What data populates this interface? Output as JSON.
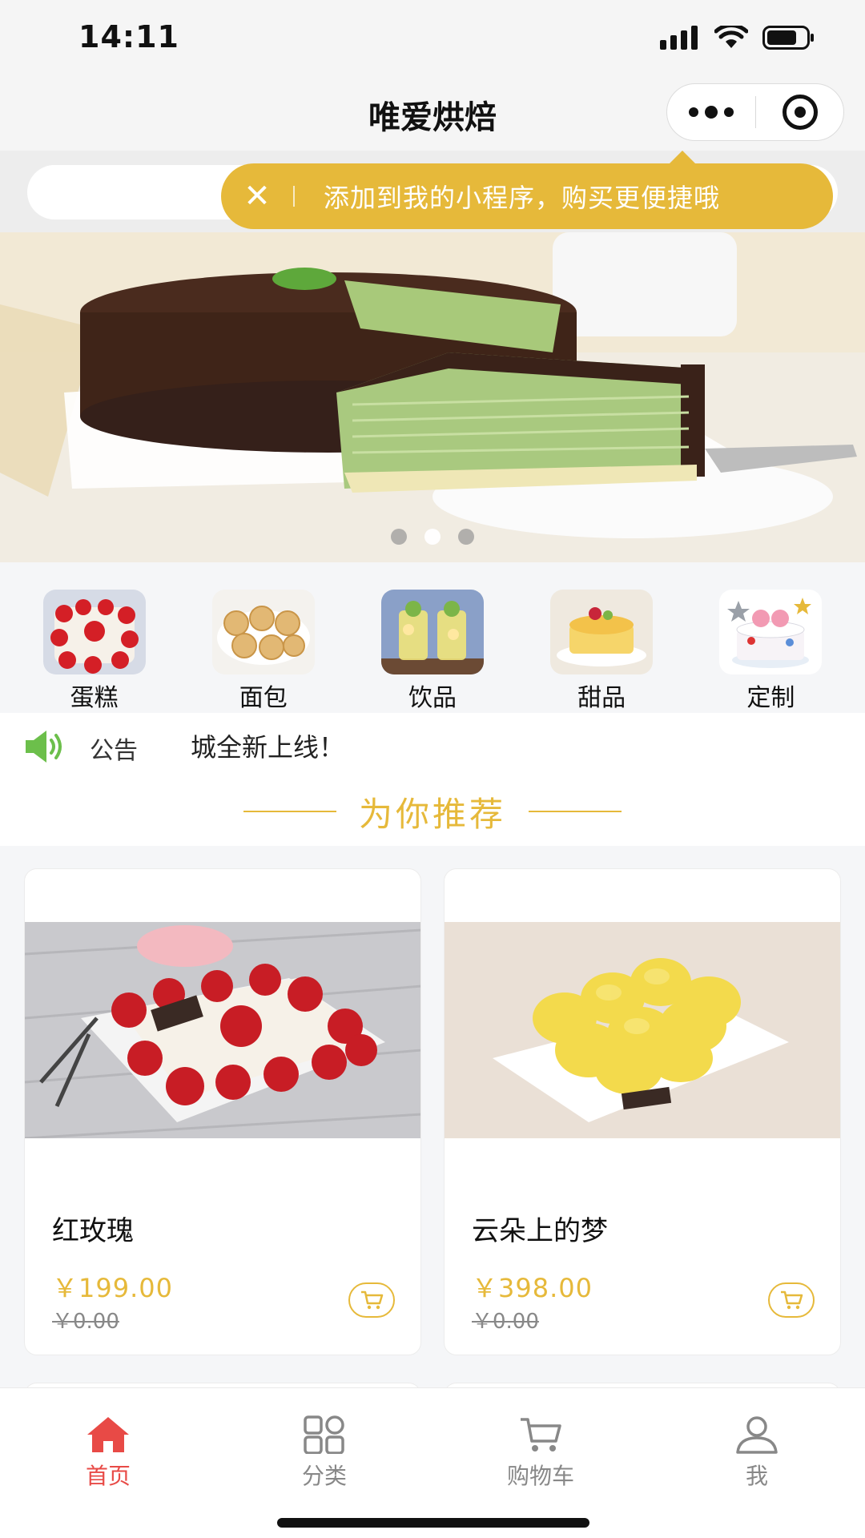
{
  "status_bar": {
    "time": "14:11"
  },
  "nav": {
    "title": "唯爱烘焙"
  },
  "search": {
    "placeholder": ""
  },
  "tip": {
    "close": "✕",
    "text": "添加到我的小程序，购买更便捷哦"
  },
  "banner": {
    "dots": 3,
    "active_dot": 2
  },
  "categories": [
    {
      "label": "蛋糕",
      "icon": "cake-icon"
    },
    {
      "label": "面包",
      "icon": "bread-icon"
    },
    {
      "label": "饮品",
      "icon": "drink-icon"
    },
    {
      "label": "甜品",
      "icon": "dessert-icon"
    },
    {
      "label": "定制",
      "icon": "custom-cake-icon"
    }
  ],
  "notice": {
    "title": "公告",
    "text": "城全新上线！"
  },
  "recommend": {
    "title": "为你推荐"
  },
  "products": [
    {
      "name": "红玫瑰",
      "price": "￥199.00",
      "original_price": "￥0.00"
    },
    {
      "name": "云朵上的梦",
      "price": "￥398.00",
      "original_price": "￥0.00"
    }
  ],
  "tabbar": [
    {
      "label": "首页",
      "icon": "home-icon",
      "active": true
    },
    {
      "label": "分类",
      "icon": "category-icon",
      "active": false
    },
    {
      "label": "购物车",
      "icon": "cart-icon",
      "active": false
    },
    {
      "label": "我",
      "icon": "user-icon",
      "active": false
    }
  ],
  "colors": {
    "accent": "#e6b93a",
    "active_tab": "#e84a46"
  }
}
